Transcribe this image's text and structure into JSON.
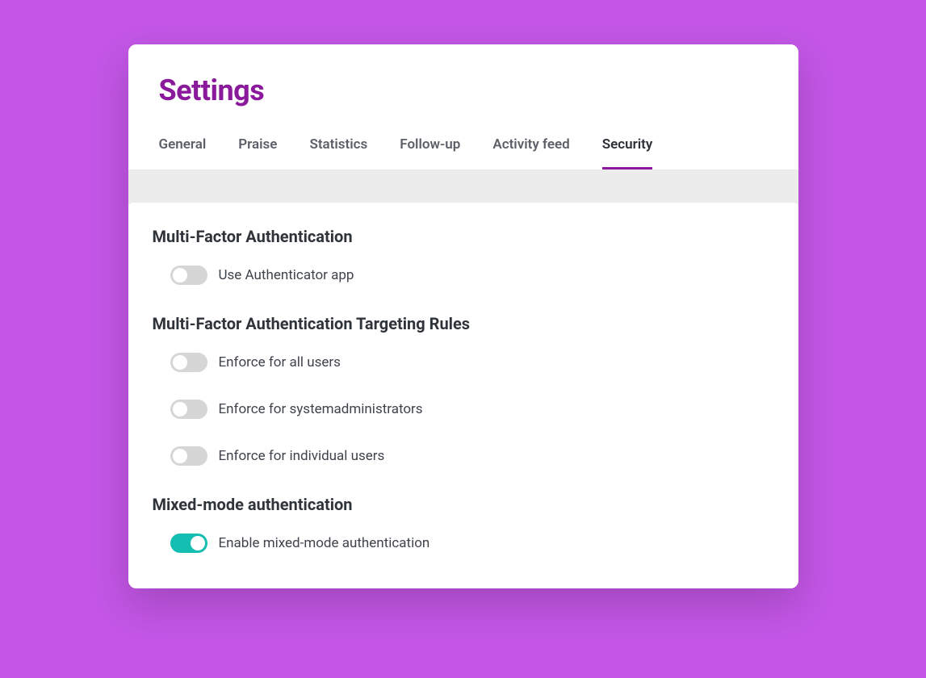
{
  "header": {
    "title": "Settings"
  },
  "tabs": [
    {
      "label": "General",
      "active": false
    },
    {
      "label": "Praise",
      "active": false
    },
    {
      "label": "Statistics",
      "active": false
    },
    {
      "label": "Follow-up",
      "active": false
    },
    {
      "label": "Activity feed",
      "active": false
    },
    {
      "label": "Security",
      "active": true
    }
  ],
  "sections": {
    "mfa": {
      "title": "Multi-Factor Authentication",
      "toggle_auth_app": {
        "label": "Use Authenticator app",
        "on": false
      }
    },
    "mfa_targeting": {
      "title": "Multi-Factor Authentication Targeting Rules",
      "toggle_all": {
        "label": "Enforce for all users",
        "on": false
      },
      "toggle_sysadmins": {
        "label": "Enforce for systemadministrators",
        "on": false
      },
      "toggle_individual": {
        "label": "Enforce for individual users",
        "on": false
      }
    },
    "mixed_mode": {
      "title": "Mixed-mode authentication",
      "toggle_enable": {
        "label": "Enable mixed-mode authentication",
        "on": true
      }
    }
  },
  "colors": {
    "accent": "#8a1a9b",
    "toggle_on": "#14beb0",
    "page_bg": "#c356e6"
  }
}
